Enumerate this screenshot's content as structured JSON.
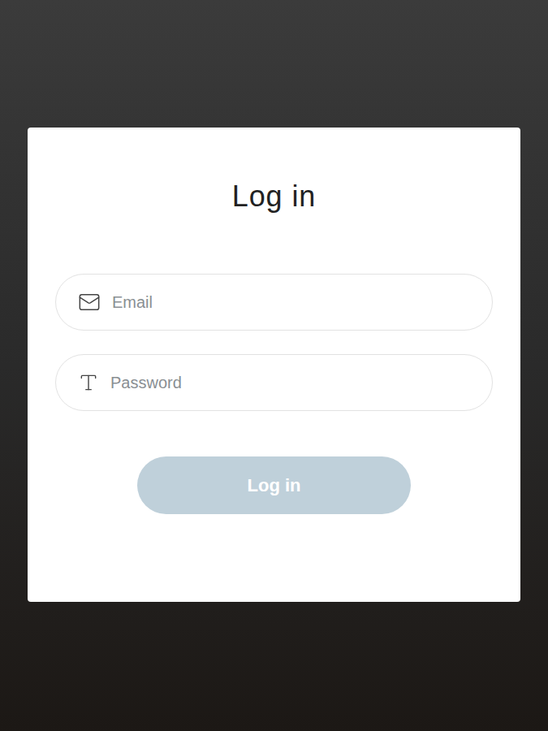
{
  "form": {
    "title": "Log in"
  },
  "fields": [
    {
      "kind": "email",
      "placeholder": "Email",
      "value": ""
    },
    {
      "kind": "password",
      "placeholder": "Password",
      "value": ""
    }
  ],
  "button": {
    "label": "Log in",
    "disabled": true
  }
}
